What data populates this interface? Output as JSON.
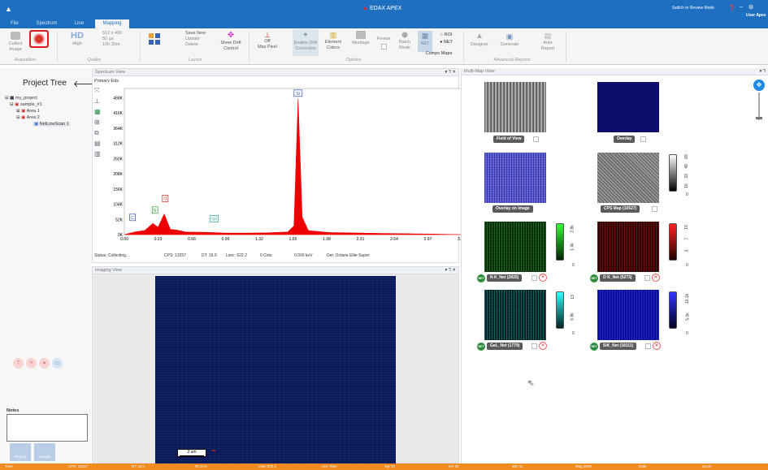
{
  "window": {
    "title": "EDAX APEX",
    "review_mode": "Switch to Review Mode",
    "user": "User Apex"
  },
  "tabs": [
    "File",
    "Spectrum",
    "Line",
    "Mapping"
  ],
  "ribbon": {
    "collect_image": "Collect Image",
    "quality_value": "HD",
    "quality_sub": "High",
    "resolution": "512 x 400",
    "dwell": "50 µs",
    "duration": "10h 30m",
    "save_new": "Save New",
    "update": "Update",
    "delete": "Delete",
    "show_drift": "Show Drift Control",
    "max_pixel_value": "Off",
    "max_pixel": "Max Pixel",
    "enable_drift": "Enable Drift Correction",
    "element_colors": "Element Colors",
    "montage": "Montage",
    "freeze": "Freeze",
    "batch_mode": "Batch Mode",
    "net": "NET",
    "roi": "ROI",
    "net_radio": "NET",
    "compo_maps": "Compo Maps",
    "designer": "Designer",
    "generate": "Generate",
    "auto_report": "Auto Report",
    "groups": {
      "acquisition": "Acquisition",
      "quality": "Quality",
      "layout": "Layout",
      "options": "Options",
      "advanced_reports": "Advanced Reports"
    }
  },
  "project_tree": {
    "title": "Project Tree",
    "items": [
      "my_project",
      "sample_#1",
      "Area 1",
      "Area 2",
      "NetLineScan 1"
    ],
    "notes_label": "Notes",
    "footer_buttons": [
      "Project",
      "Sample"
    ]
  },
  "spectrum_view": {
    "header": "Spectrum View",
    "subtitle": "Primary Eds",
    "status": "Status: Collecting...",
    "cps": "CPS: 13257",
    "dt": "DT: 19.0",
    "lsec": "Lsec: 622.2",
    "cnts": "0 Cnts",
    "kev": "0.000 keV",
    "det": "Det: Octane Elite Super"
  },
  "chart_data": {
    "type": "area",
    "x": [
      0.0,
      0.1,
      0.2,
      0.28,
      0.33,
      0.39,
      0.45,
      0.52,
      0.6,
      0.8,
      1.0,
      1.2,
      1.4,
      1.6,
      1.66,
      1.7,
      1.74,
      1.8,
      2.0,
      2.5,
      3.0,
      3.3
    ],
    "y": [
      0,
      9000,
      14000,
      38000,
      25000,
      70000,
      18000,
      15000,
      9000,
      8000,
      5000,
      5000,
      6000,
      9000,
      30000,
      465000,
      60000,
      14000,
      7000,
      4000,
      2000,
      0
    ],
    "xticks": [
      "0.00",
      "0.33",
      "0.66",
      "0.99",
      "1.32",
      "1.65",
      "1.98",
      "2.31",
      "2.64",
      "2.97",
      "3.30"
    ],
    "yticks": [
      "0K",
      "52K",
      "104K",
      "156K",
      "208K",
      "260K",
      "312K",
      "364K",
      "416K",
      "468K"
    ],
    "xlim": [
      0,
      3.3
    ],
    "ylim": [
      0,
      500000
    ],
    "labels": [
      {
        "text": "C",
        "x": 0.08,
        "y": 45000,
        "color": "#2a4cc2"
      },
      {
        "text": "N",
        "x": 0.3,
        "y": 70000,
        "color": "#2a9a2a"
      },
      {
        "text": "O",
        "x": 0.4,
        "y": 110000,
        "color": "#d22"
      },
      {
        "text": "Ge",
        "x": 0.88,
        "y": 40000,
        "color": "#28a0a0"
      },
      {
        "text": "Si",
        "x": 1.7,
        "y": 470000,
        "color": "#2a4cc2"
      }
    ],
    "color": "#ee0000"
  },
  "imaging_view": {
    "header": "Imaging View",
    "scale": "2 um"
  },
  "multimap": {
    "header": "Multi-Map View",
    "tiles": [
      {
        "label": "Field of View"
      },
      {
        "label": "Overlay"
      },
      {
        "label": "Overlay on Image"
      },
      {
        "label": "CPS Map (10527)",
        "ticks": [
          "65",
          "49",
          "33",
          "16",
          "0"
        ]
      },
      {
        "label": "N K_Net (2825)",
        "ticks": [
          "2.8k",
          "1.4k",
          "0"
        ]
      },
      {
        "label": "O K_Net (5273)",
        "ticks": [
          "10",
          "7",
          "3",
          "0"
        ]
      },
      {
        "label": "GeL_Net (1779)",
        "ticks": [
          "13",
          "6.8k",
          "0"
        ]
      },
      {
        "label": "SiK_Net (18111)",
        "ticks": [
          "10.1k",
          "5.0k",
          "0"
        ]
      }
    ],
    "net_badge": "NET"
  },
  "status_bar": [
    "Time",
    "CPS: 13257",
    "DT 19.0",
    "Rt 10.0",
    "Lsec 622.2",
    "Ace Time",
    "Ep 10",
    "HV 20",
    "WD 11",
    "Mag 2000",
    "Date",
    "Zoom"
  ]
}
